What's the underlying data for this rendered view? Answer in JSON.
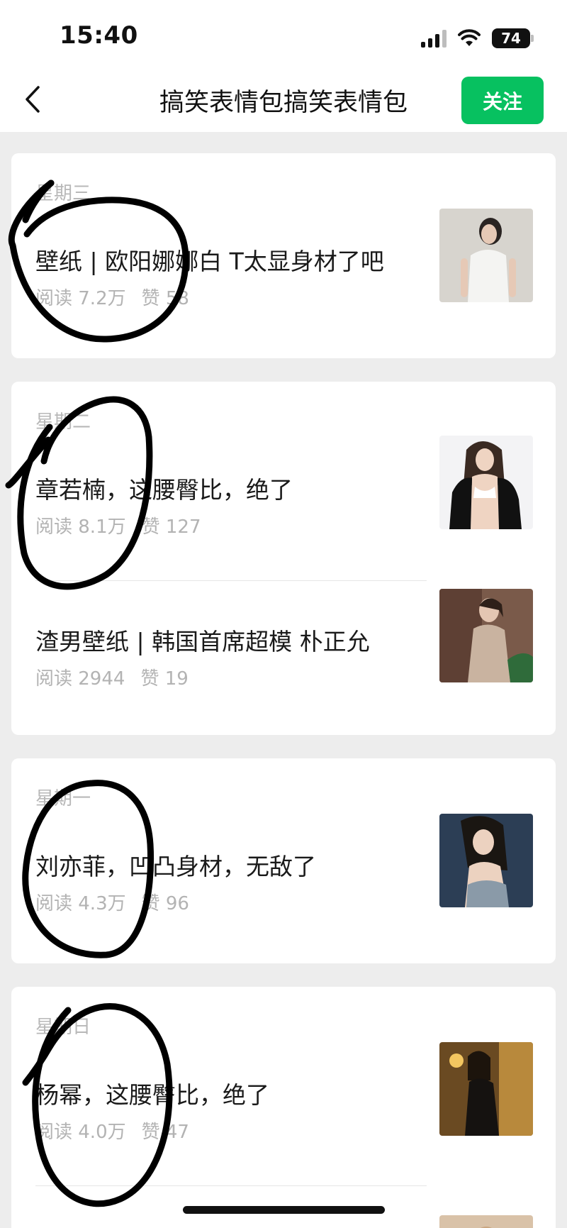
{
  "status_bar": {
    "time": "15:40",
    "battery": "74"
  },
  "header": {
    "title": "搞笑表情包搞笑表情包",
    "follow_label": "关注"
  },
  "groups": [
    {
      "day": "星期三",
      "items": [
        {
          "title": "壁纸 | 欧阳娜娜白 T太显身材了吧",
          "reads": "阅读 7.2万",
          "likes": "赞 58",
          "thumb": "photo-white-tee"
        }
      ]
    },
    {
      "day": "星期二",
      "items": [
        {
          "title": "章若楠，这腰臀比，绝了",
          "reads": "阅读 8.1万",
          "likes": "赞 127",
          "thumb": "photo-black-jacket"
        },
        {
          "title": "渣男壁纸 | 韩国首席超模 朴正允",
          "reads": "阅读 2944",
          "likes": "赞 19",
          "thumb": "photo-beige-sweater"
        }
      ]
    },
    {
      "day": "星期一",
      "items": [
        {
          "title": "刘亦菲，凹凸身材，无敌了",
          "reads": "阅读 4.3万",
          "likes": "赞 96",
          "thumb": "photo-dark-dress"
        }
      ]
    },
    {
      "day": "星期日",
      "items": [
        {
          "title": "杨幂，这腰臀比，绝了",
          "reads": "阅读 4.0万",
          "likes": "赞 47",
          "thumb": "photo-gold-room"
        }
      ]
    }
  ],
  "colors": {
    "accent": "#07c160",
    "background": "#ededed",
    "meta_text": "#b3b3b3",
    "ink": "#000000"
  }
}
